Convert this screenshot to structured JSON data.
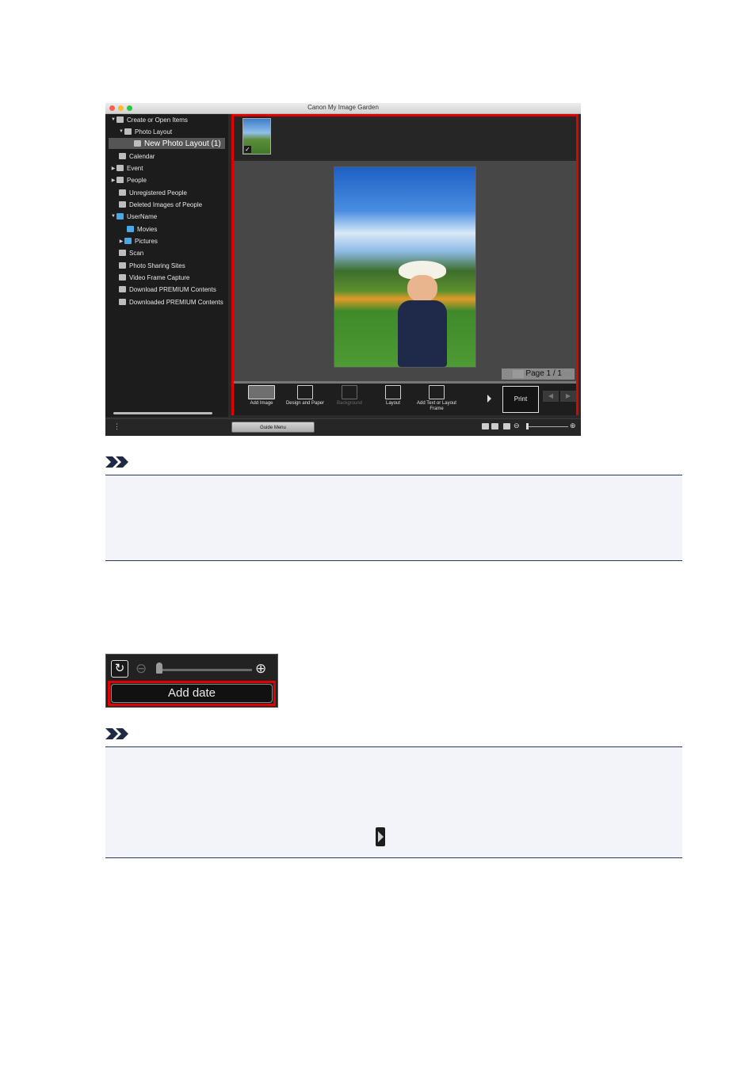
{
  "app": {
    "title": "Canon My Image Garden",
    "sidebar": {
      "items": [
        {
          "label": "Create or Open Items",
          "arrow": "▼"
        },
        {
          "label": "Photo Layout",
          "arrow": "▼"
        },
        {
          "label": "New Photo Layout (1)",
          "arrow": "",
          "selected": true
        },
        {
          "label": "Calendar",
          "arrow": ""
        },
        {
          "label": "Event",
          "arrow": "▶"
        },
        {
          "label": "People",
          "arrow": "▶"
        },
        {
          "label": "Unregistered People",
          "arrow": ""
        },
        {
          "label": "Deleted Images of People",
          "arrow": ""
        },
        {
          "label": "UserName",
          "arrow": "▼"
        },
        {
          "label": "Movies",
          "arrow": ""
        },
        {
          "label": "Pictures",
          "arrow": "▶"
        },
        {
          "label": "Scan",
          "arrow": ""
        },
        {
          "label": "Photo Sharing Sites",
          "arrow": ""
        },
        {
          "label": "Video Frame Capture",
          "arrow": ""
        },
        {
          "label": "Download PREMIUM Contents",
          "arrow": ""
        },
        {
          "label": "Downloaded PREMIUM Contents",
          "arrow": ""
        }
      ]
    },
    "thumbnail": {
      "check": "✓"
    },
    "page_indicator": "Page 1 / 1",
    "toolbar": {
      "add_image": "Add Image",
      "design_and_paper": "Design and Paper",
      "background": "Background",
      "layout": "Layout",
      "add_text_or_layout_frame": "Add Text or Layout Frame",
      "print": "Print",
      "prev": "◀",
      "next": "▶"
    },
    "statusbar": {
      "menu_dots": "⋮",
      "guide_menu": "Guide Menu",
      "zoom_out": "⊖",
      "zoom_in": "⊕"
    }
  },
  "date_widget": {
    "rotate": "↻",
    "zoom_out": "⊖",
    "zoom_in": "⊕",
    "add_date_label": "Add date"
  },
  "colors": {
    "highlight": "#e00000",
    "note_border": "#2b3a55",
    "note_background": "#f3f4fa"
  },
  "icons": [
    "note-chevron-icon",
    "more-arrow-icon",
    "rotate-icon",
    "zoom-out-icon",
    "zoom-in-icon",
    "next-arrow-icon"
  ]
}
